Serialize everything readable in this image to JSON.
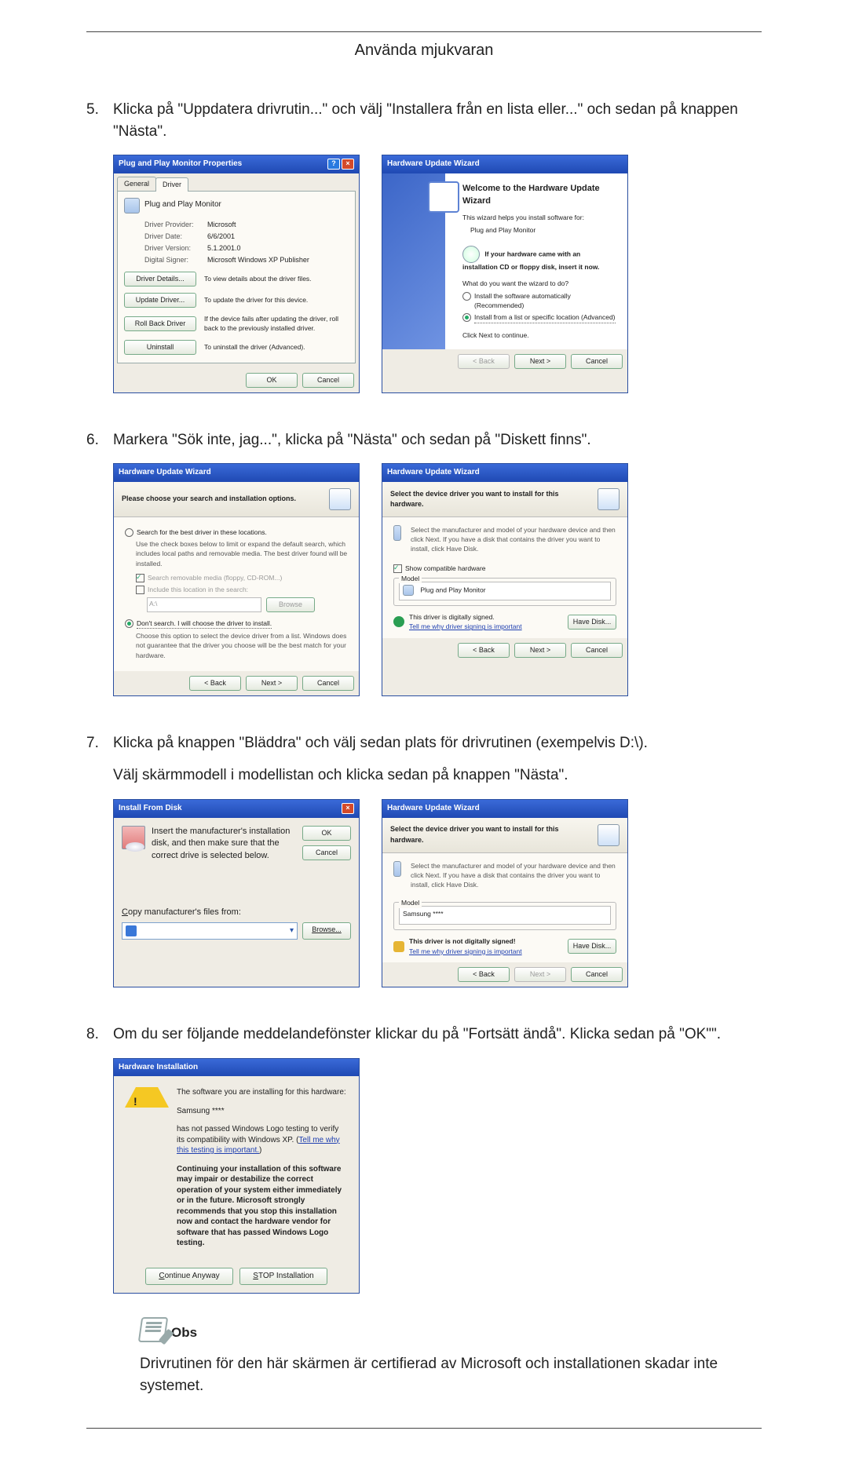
{
  "header": {
    "title": "Använda mjukvaran"
  },
  "steps": {
    "s5": {
      "num": "5.",
      "text": "Klicka på \"Uppdatera drivrutin...\" och välj \"Installera från en lista eller...\" och sedan på knappen \"Nästa\"."
    },
    "s6": {
      "num": "6.",
      "text": "Markera \"Sök inte, jag...\", klicka på \"Nästa\" och sedan på \"Diskett finns\"."
    },
    "s7": {
      "num": "7.",
      "text1": "Klicka på knappen \"Bläddra\" och välj sedan plats för drivrutinen (exempelvis D:\\).",
      "text2": "Välj skärmmodell i modellistan och klicka sedan på knappen \"Nästa\"."
    },
    "s8": {
      "num": "8.",
      "text": "Om du ser följande meddelandefönster klickar du på \"Fortsätt ändå\". Klicka sedan på \"OK\"\"."
    }
  },
  "dlg_props": {
    "title": "Plug and Play Monitor Properties",
    "tab_general": "General",
    "tab_driver": "Driver",
    "monitor_name": "Plug and Play Monitor",
    "rows": {
      "provider_k": "Driver Provider:",
      "provider_v": "Microsoft",
      "date_k": "Driver Date:",
      "date_v": "6/6/2001",
      "version_k": "Driver Version:",
      "version_v": "5.1.2001.0",
      "signer_k": "Digital Signer:",
      "signer_v": "Microsoft Windows XP Publisher"
    },
    "buttons": {
      "details": "Driver Details...",
      "details_d": "To view details about the driver files.",
      "update": "Update Driver...",
      "update_d": "To update the driver for this device.",
      "rollback": "Roll Back Driver",
      "rollback_d": "If the device fails after updating the driver, roll back to the previously installed driver.",
      "uninstall": "Uninstall",
      "uninstall_d": "To uninstall the driver (Advanced).",
      "ok": "OK",
      "cancel": "Cancel"
    }
  },
  "dlg_wiz_welcome": {
    "title": "Hardware Update Wizard",
    "heading": "Welcome to the Hardware Update Wizard",
    "p1": "This wizard helps you install software for:",
    "device": "Plug and Play Monitor",
    "cd_hint": "If your hardware came with an installation CD or floppy disk, insert it now.",
    "q": "What do you want the wizard to do?",
    "r1": "Install the software automatically (Recommended)",
    "r2": "Install from a list or specific location (Advanced)",
    "p_cont": "Click Next to continue.",
    "back": "< Back",
    "next": "Next >",
    "cancel": "Cancel"
  },
  "dlg_wiz_search": {
    "title": "Hardware Update Wizard",
    "header": "Please choose your search and installation options.",
    "r_search": "Search for the best driver in these locations.",
    "r_search_sub": "Use the check boxes below to limit or expand the default search, which includes local paths and removable media. The best driver found will be installed.",
    "chk_removable": "Search removable media (floppy, CD-ROM...)",
    "chk_include": "Include this location in the search:",
    "loc_value": "A:\\",
    "browse": "Browse",
    "r_dont": "Don't search. I will choose the driver to install.",
    "r_dont_sub": "Choose this option to select the device driver from a list. Windows does not guarantee that the driver you choose will be the best match for your hardware.",
    "back": "< Back",
    "next": "Next >",
    "cancel": "Cancel"
  },
  "dlg_wiz_select1": {
    "title": "Hardware Update Wizard",
    "header": "Select the device driver you want to install for this hardware.",
    "intro": "Select the manufacturer and model of your hardware device and then click Next. If you have a disk that contains the driver you want to install, click Have Disk.",
    "chk_compat": "Show compatible hardware",
    "model_label": "Model",
    "model_item": "Plug and Play Monitor",
    "sig_ok": "This driver is digitally signed.",
    "sig_link": "Tell me why driver signing is important",
    "have_disk": "Have Disk...",
    "back": "< Back",
    "next": "Next >",
    "cancel": "Cancel"
  },
  "dlg_ifd": {
    "title": "Install From Disk",
    "msg": "Insert the manufacturer's installation disk, and then make sure that the correct drive is selected below.",
    "ok": "OK",
    "cancel": "Cancel",
    "copy_label": "Copy manufacturer's files from:",
    "path": " ",
    "browse": "Browse..."
  },
  "dlg_wiz_select2": {
    "title": "Hardware Update Wizard",
    "header": "Select the device driver you want to install for this hardware.",
    "intro": "Select the manufacturer and model of your hardware device and then click Next. If you have a disk that contains the driver you want to install, click Have Disk.",
    "model_label": "Model",
    "model_item": "Samsung ****",
    "sig_warn": "This driver is not digitally signed!",
    "sig_link": "Tell me why driver signing is important",
    "have_disk": "Have Disk...",
    "back": "< Back",
    "next": "Next >",
    "cancel": "Cancel"
  },
  "dlg_hwinst": {
    "title": "Hardware Installation",
    "p1": "The software you are installing for this hardware:",
    "device": "Samsung ****",
    "p2a": "has not passed Windows Logo testing to verify its compatibility with Windows XP. (",
    "p2_link": "Tell me why this testing is important.",
    "p2b": ")",
    "p3": "Continuing your installation of this software may impair or destabilize the correct operation of your system either immediately or in the future. Microsoft strongly recommends that you stop this installation now and contact the hardware vendor for software that has passed Windows Logo testing.",
    "btn_cont": "Continue Anyway",
    "btn_stop": "STOP Installation"
  },
  "obs": {
    "label": "Obs",
    "text": "Drivrutinen för den här skärmen är certifierad av Microsoft och installationen skadar inte systemet."
  }
}
